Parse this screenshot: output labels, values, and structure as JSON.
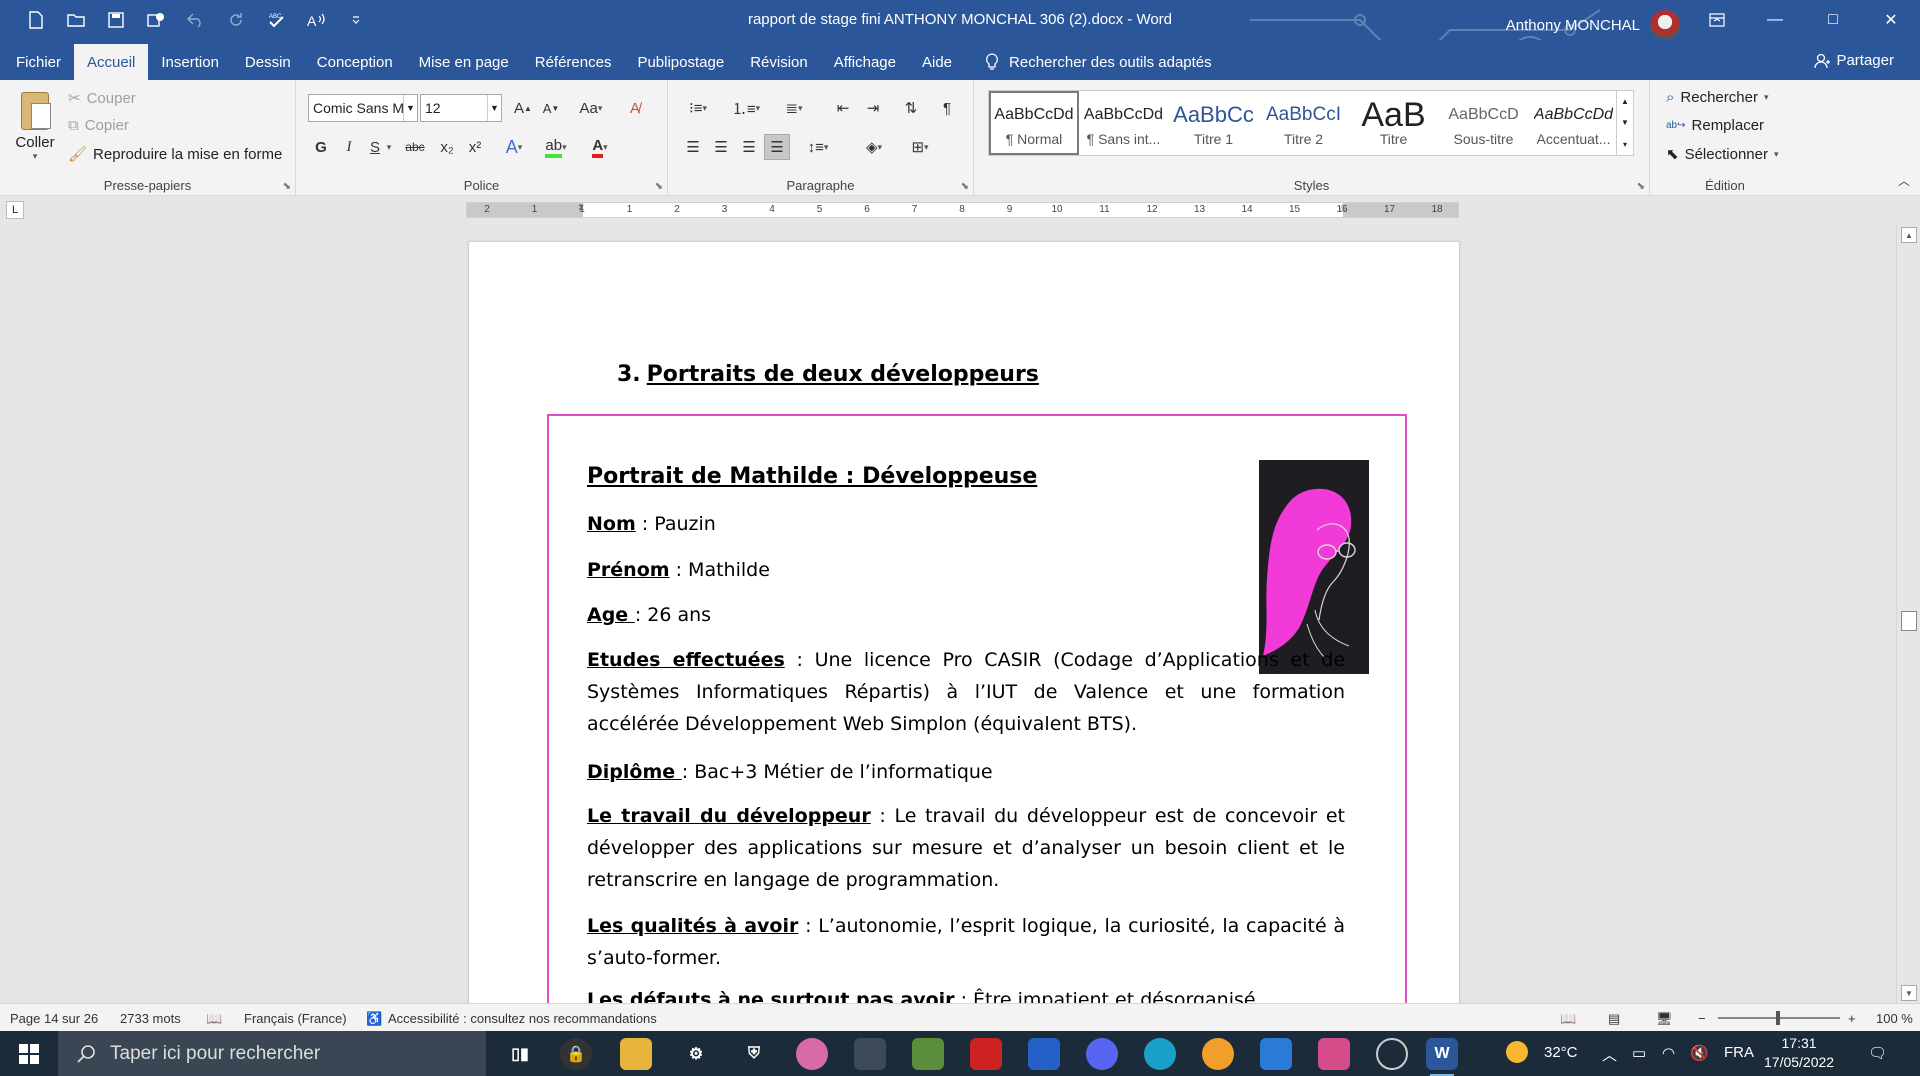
{
  "window": {
    "title": "rapport de stage fini ANTHONY MONCHAL 306 (2).docx  -  Word",
    "user": "Anthony MONCHAL",
    "controls": [
      "—",
      "□",
      "✕"
    ]
  },
  "tabs": [
    "Fichier",
    "Accueil",
    "Insertion",
    "Dessin",
    "Conception",
    "Mise en page",
    "Références",
    "Publipostage",
    "Révision",
    "Affichage",
    "Aide"
  ],
  "active_tab": "Accueil",
  "tell_me": "Rechercher des outils adaptés",
  "share": "Partager",
  "clipboard": {
    "paste": "Coller",
    "cut": "Couper",
    "copy": "Copier",
    "format_painter": "Reproduire la mise en forme",
    "label": "Presse-papiers"
  },
  "font": {
    "name": "Comic Sans M",
    "size": "12",
    "label": "Police",
    "bold": "G",
    "italic": "I",
    "underline": "S",
    "strike": "abc",
    "subscript": "x₂",
    "superscript": "x²",
    "grow": "A",
    "shrink": "A",
    "case": "Aa"
  },
  "paragraph": {
    "label": "Paragraphe"
  },
  "styles": {
    "label": "Styles",
    "items": [
      {
        "sample": "AaBbCcDd",
        "name": "¶ Normal"
      },
      {
        "sample": "AaBbCcDd",
        "name": "¶ Sans int..."
      },
      {
        "sample": "AaBbCc",
        "name": "Titre 1"
      },
      {
        "sample": "AaBbCcI",
        "name": "Titre 2"
      },
      {
        "sample": "AaB",
        "name": "Titre"
      },
      {
        "sample": "AaBbCcD",
        "name": "Sous-titre"
      },
      {
        "sample": "AaBbCcDd",
        "name": "Accentuat..."
      }
    ]
  },
  "editing": {
    "label": "Édition",
    "find": "Rechercher",
    "replace": "Remplacer",
    "select": "Sélectionner"
  },
  "ruler": {
    "ticks": [
      "2",
      "1",
      "1",
      "1",
      "2",
      "3",
      "4",
      "5",
      "6",
      "7",
      "8",
      "9",
      "10",
      "11",
      "12",
      "13",
      "14",
      "15",
      "16",
      "17",
      "18"
    ]
  },
  "document": {
    "heading_number": "3.",
    "heading_text": "Portraits de deux développeurs",
    "box_title": "Portrait de Mathilde : Développeuse",
    "fields": [
      {
        "label": "Nom",
        "sep": " : ",
        "value": "Pauzin"
      },
      {
        "label": "Prénom",
        "sep": " : ",
        "value": "Mathilde"
      },
      {
        "label": "Age ",
        "sep": ": ",
        "value": "26 ans"
      },
      {
        "label": "Etudes effectuées",
        "sep": " : ",
        "value": "Une licence Pro CASIR (Codage d’Applications et de Systèmes Informatiques Répartis) à l’IUT de Valence et une formation accélérée Développement Web Simplon (équivalent BTS)."
      },
      {
        "label": "Diplôme ",
        "sep": ": ",
        "value": "Bac+3 Métier de l’informatique"
      },
      {
        "label": "Le travail du développeur",
        "sep": " : ",
        "value": "Le travail du développeur est de concevoir et développer des applications sur mesure et d’analyser un besoin client et le retranscrire en langage de programmation."
      },
      {
        "label": "Les qualités à avoir",
        "sep": " : ",
        "value": "L’autonomie, l’esprit logique, la curiosité, la capacité à s’auto-former."
      },
      {
        "label": "Les défauts à ne surtout pas avoir",
        "sep": " : ",
        "value": "Être impatient et désorganisé."
      }
    ]
  },
  "status": {
    "page": "Page 14 sur 26",
    "words": "2733 mots",
    "language": "Français (France)",
    "accessibility": "Accessibilité : consultez nos recommandations",
    "zoom": "100 %",
    "zoom_minus": "−",
    "zoom_plus": "+"
  },
  "taskbar": {
    "search_placeholder": "Taper ici pour rechercher",
    "weather": "32°C",
    "language": "FRA",
    "time": "17:31",
    "date": "17/05/2022"
  },
  "colors": {
    "word_blue": "#2b579a",
    "box_border": "#e44dc6",
    "portrait_pink": "#f23ad8",
    "taskbar": "#1c2b3a"
  }
}
